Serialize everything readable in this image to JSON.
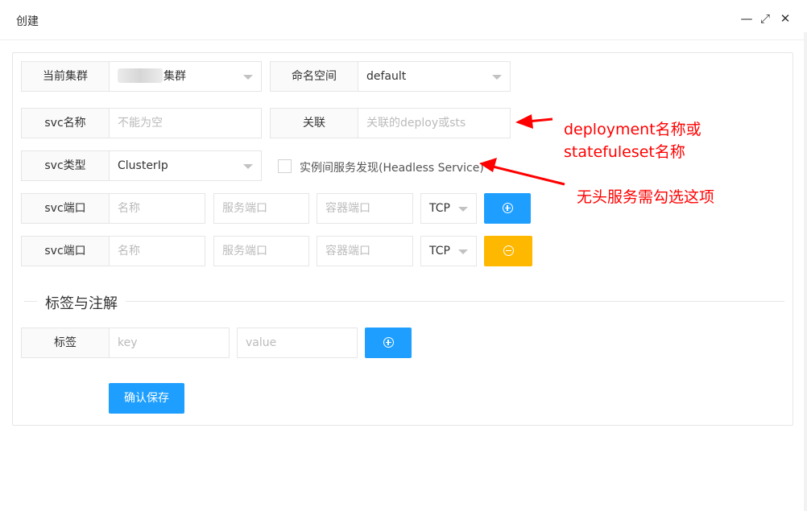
{
  "dialog": {
    "title": "创建"
  },
  "window_controls": {
    "minimize": "—",
    "maximize": "⤢",
    "close": "✕"
  },
  "form": {
    "cluster": {
      "label": "当前集群",
      "value": "集群"
    },
    "namespace": {
      "label": "命名空间",
      "value": "default"
    },
    "svc_name": {
      "label": "svc名称",
      "placeholder": "不能为空"
    },
    "relation": {
      "label": "关联",
      "placeholder": "关联的deploy或sts"
    },
    "svc_type": {
      "label": "svc类型",
      "value": "ClusterIp"
    },
    "headless": {
      "label": "实例间服务发现(Headless Service)",
      "checked": false
    },
    "ports": [
      {
        "label": "svc端口",
        "name_placeholder": "名称",
        "service_port_placeholder": "服务端口",
        "container_port_placeholder": "容器端口",
        "protocol": "TCP",
        "action": "add"
      },
      {
        "label": "svc端口",
        "name_placeholder": "名称",
        "service_port_placeholder": "服务端口",
        "container_port_placeholder": "容器端口",
        "protocol": "TCP",
        "action": "remove"
      }
    ],
    "labels_section": {
      "title": "标签与注解"
    },
    "tag": {
      "label": "标签",
      "key_placeholder": "key",
      "value_placeholder": "value"
    },
    "save_label": "确认保存"
  },
  "annotations": {
    "relation_note_line1": "deployment名称或",
    "relation_note_line2": "statefuleset名称",
    "headless_note": "无头服务需勾选这项"
  },
  "colors": {
    "primary": "#1e9fff",
    "warning": "#ffb800",
    "annotation": "#ff0000"
  }
}
